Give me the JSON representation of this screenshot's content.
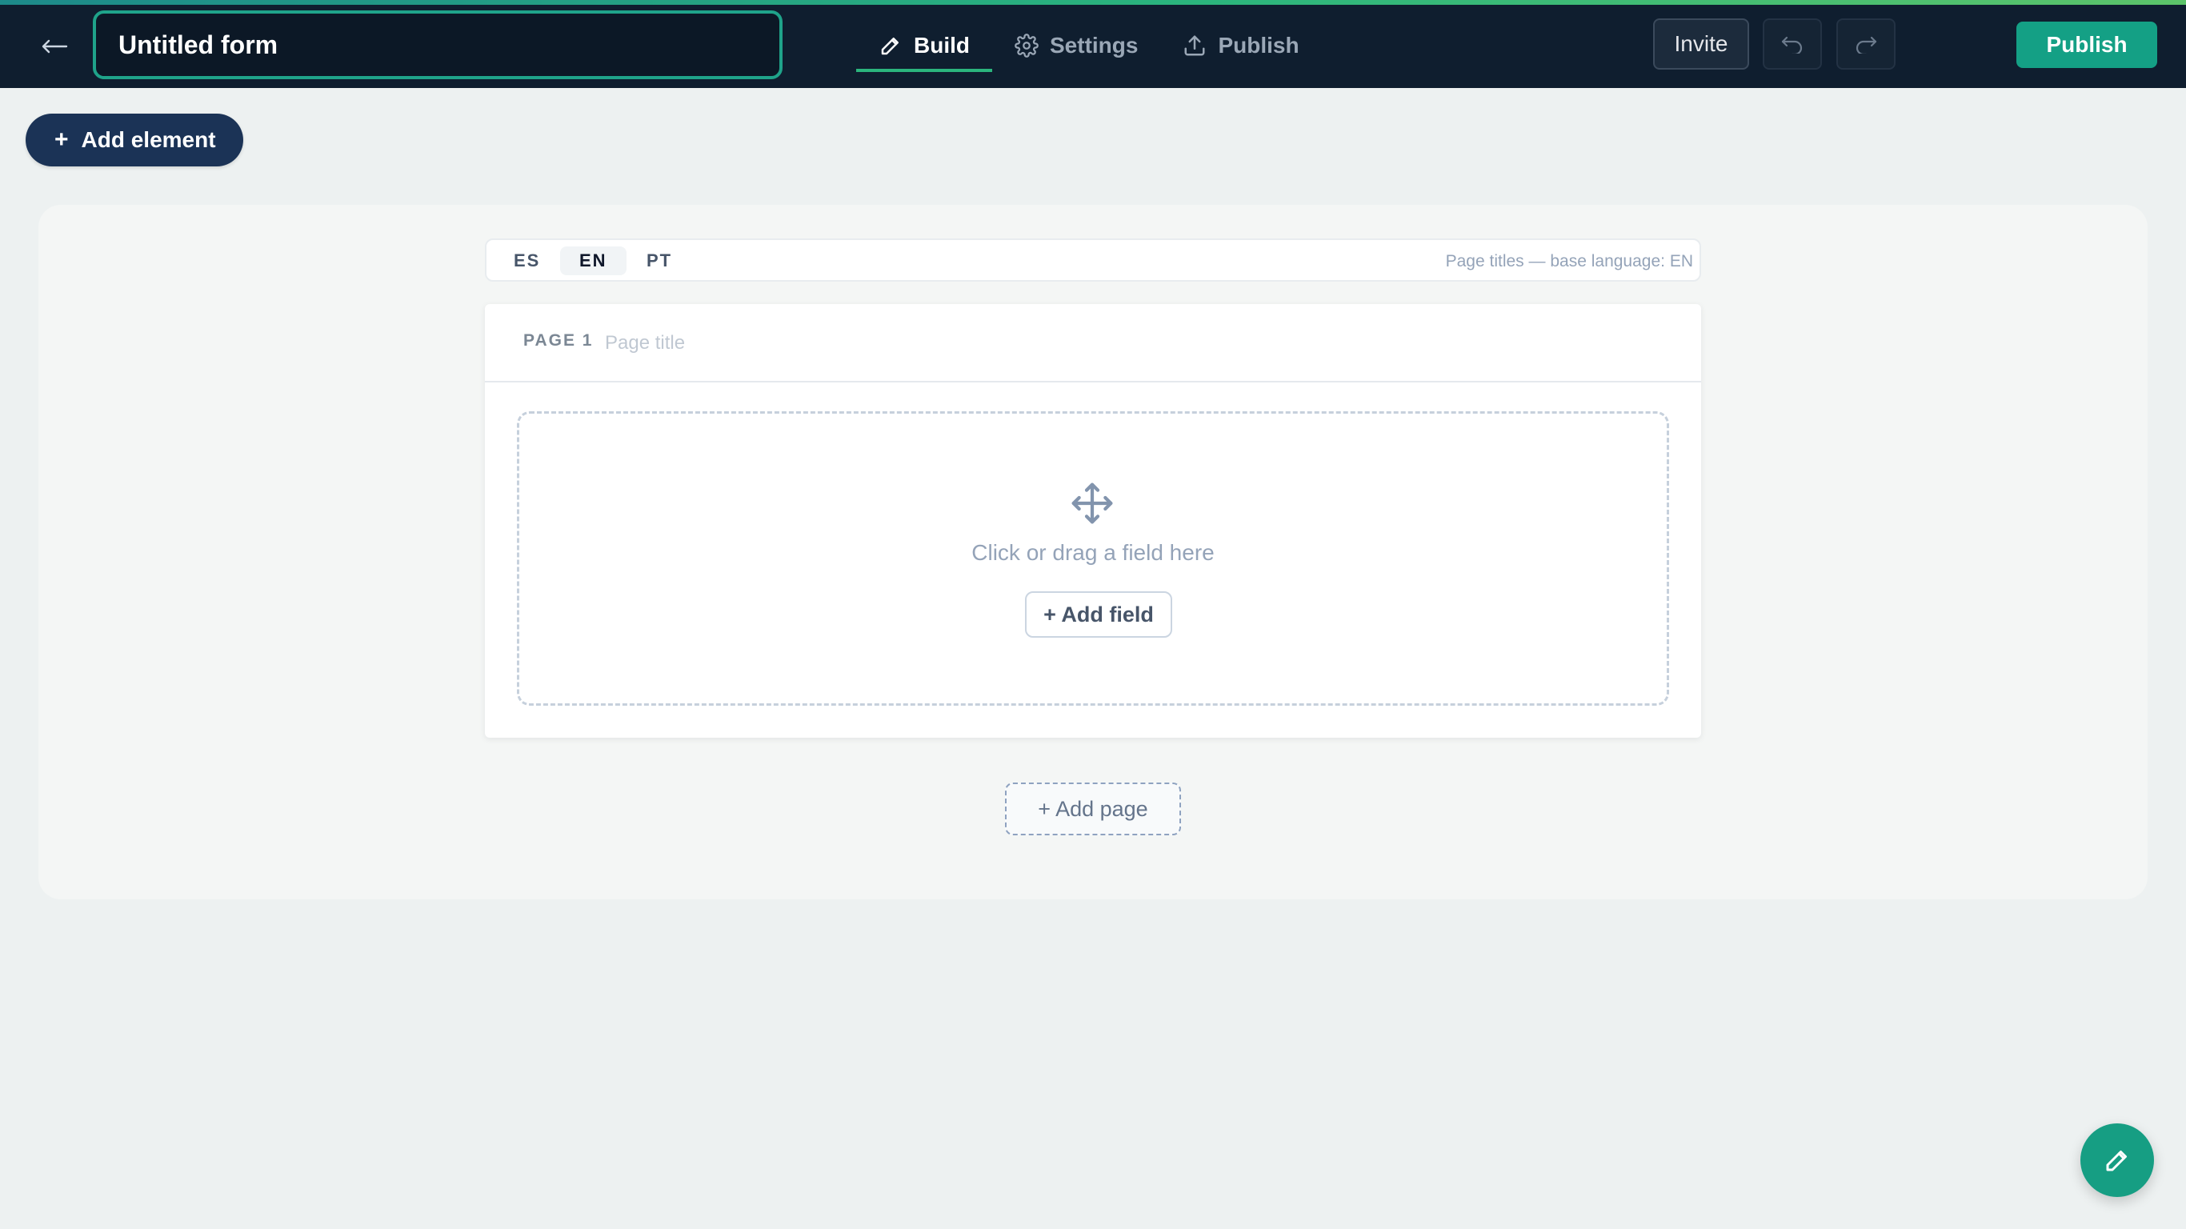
{
  "header": {
    "form_title": "Untitled form",
    "tabs": [
      {
        "label": "Build",
        "icon": "pencil-icon",
        "active": true
      },
      {
        "label": "Settings",
        "icon": "gear-icon",
        "active": false
      },
      {
        "label": "Publish",
        "icon": "upload-icon",
        "active": false
      }
    ],
    "invite_label": "Invite",
    "publish_label": "Publish"
  },
  "toolbar": {
    "add_element_label": "Add element",
    "add_element_icon": "+"
  },
  "languages": {
    "items": [
      {
        "code": "ES",
        "active": false
      },
      {
        "code": "EN",
        "active": true
      },
      {
        "code": "PT",
        "active": false
      }
    ],
    "note": "Page titles — base language: EN"
  },
  "page": {
    "label": "PAGE 1",
    "title_value": "",
    "title_placeholder": "Page title",
    "dropzone_text": "Click or drag a field here",
    "add_field_label": "+ Add field"
  },
  "add_page_label": "+ Add page",
  "colors": {
    "topbar": "#0f1e2f",
    "accent": "#14a085",
    "add_element": "#1b3356"
  }
}
